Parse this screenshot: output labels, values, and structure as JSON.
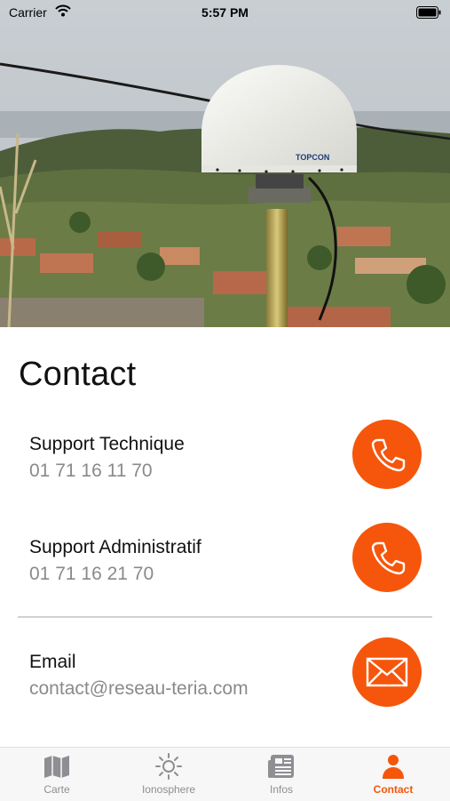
{
  "status_bar": {
    "carrier": "Carrier",
    "time": "5:57 PM"
  },
  "hero": {
    "brand": "TOPCON"
  },
  "page": {
    "title": "Contact"
  },
  "contacts": [
    {
      "name": "Support Technique",
      "value": "01 71 16 11 70",
      "action_icon": "phone-icon"
    },
    {
      "name": "Support Administratif",
      "value": "01 71 16 21 70",
      "action_icon": "phone-icon"
    },
    {
      "name": "Email",
      "value": "contact@reseau-teria.com",
      "action_icon": "envelope-icon"
    }
  ],
  "tabs": [
    {
      "label": "Carte",
      "icon": "map-icon",
      "active": false
    },
    {
      "label": "Ionosphere",
      "icon": "sun-icon",
      "active": false
    },
    {
      "label": "Infos",
      "icon": "newspaper-icon",
      "active": false
    },
    {
      "label": "Contact",
      "icon": "person-icon",
      "active": true
    }
  ],
  "colors": {
    "accent": "#f5560b",
    "inactive_tab": "#8e8e93",
    "secondary_text": "#8a8a8e"
  }
}
